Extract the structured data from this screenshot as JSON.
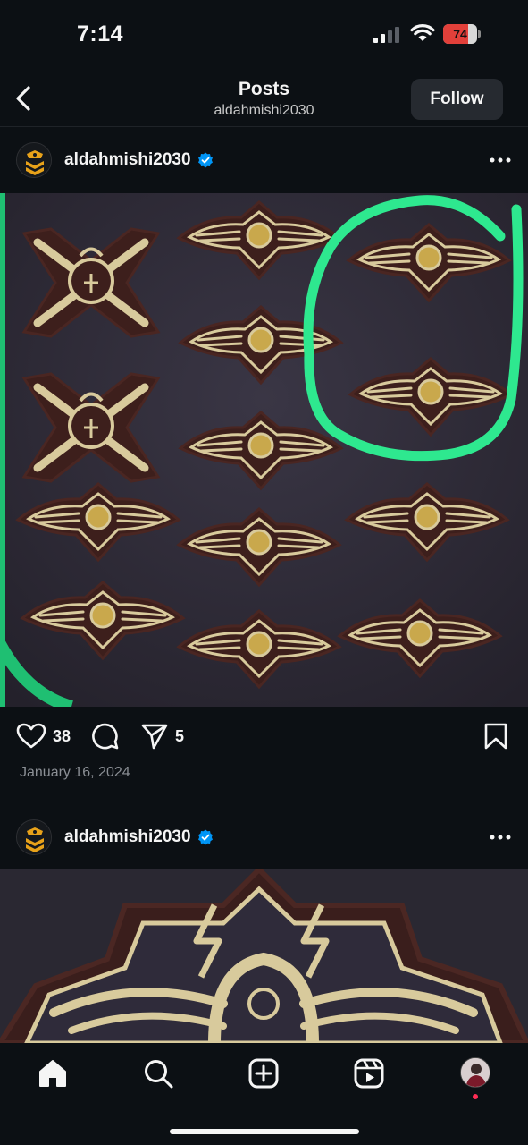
{
  "status_bar": {
    "time": "7:14",
    "battery_level": "74",
    "battery_pct": 0.74
  },
  "header": {
    "title": "Posts",
    "subtitle": "aldahmishi2030",
    "follow_label": "Follow"
  },
  "posts": [
    {
      "username": "aldahmishi2030",
      "verified": true,
      "likes": "38",
      "shares": "5",
      "date": "January 16, 2024",
      "image_desc_icon": "military-patches-photo"
    },
    {
      "username": "aldahmishi2030",
      "verified": true,
      "image_desc_icon": "patch-closeup-photo"
    }
  ],
  "bottom_nav": {
    "items": [
      "home-icon",
      "search-icon",
      "create-icon",
      "reels-icon",
      "profile-avatar"
    ]
  },
  "colors": {
    "background": "#0c1014",
    "verified": "#0095f6",
    "highlight": "#2ee88f",
    "follow_bg": "#262a30"
  }
}
